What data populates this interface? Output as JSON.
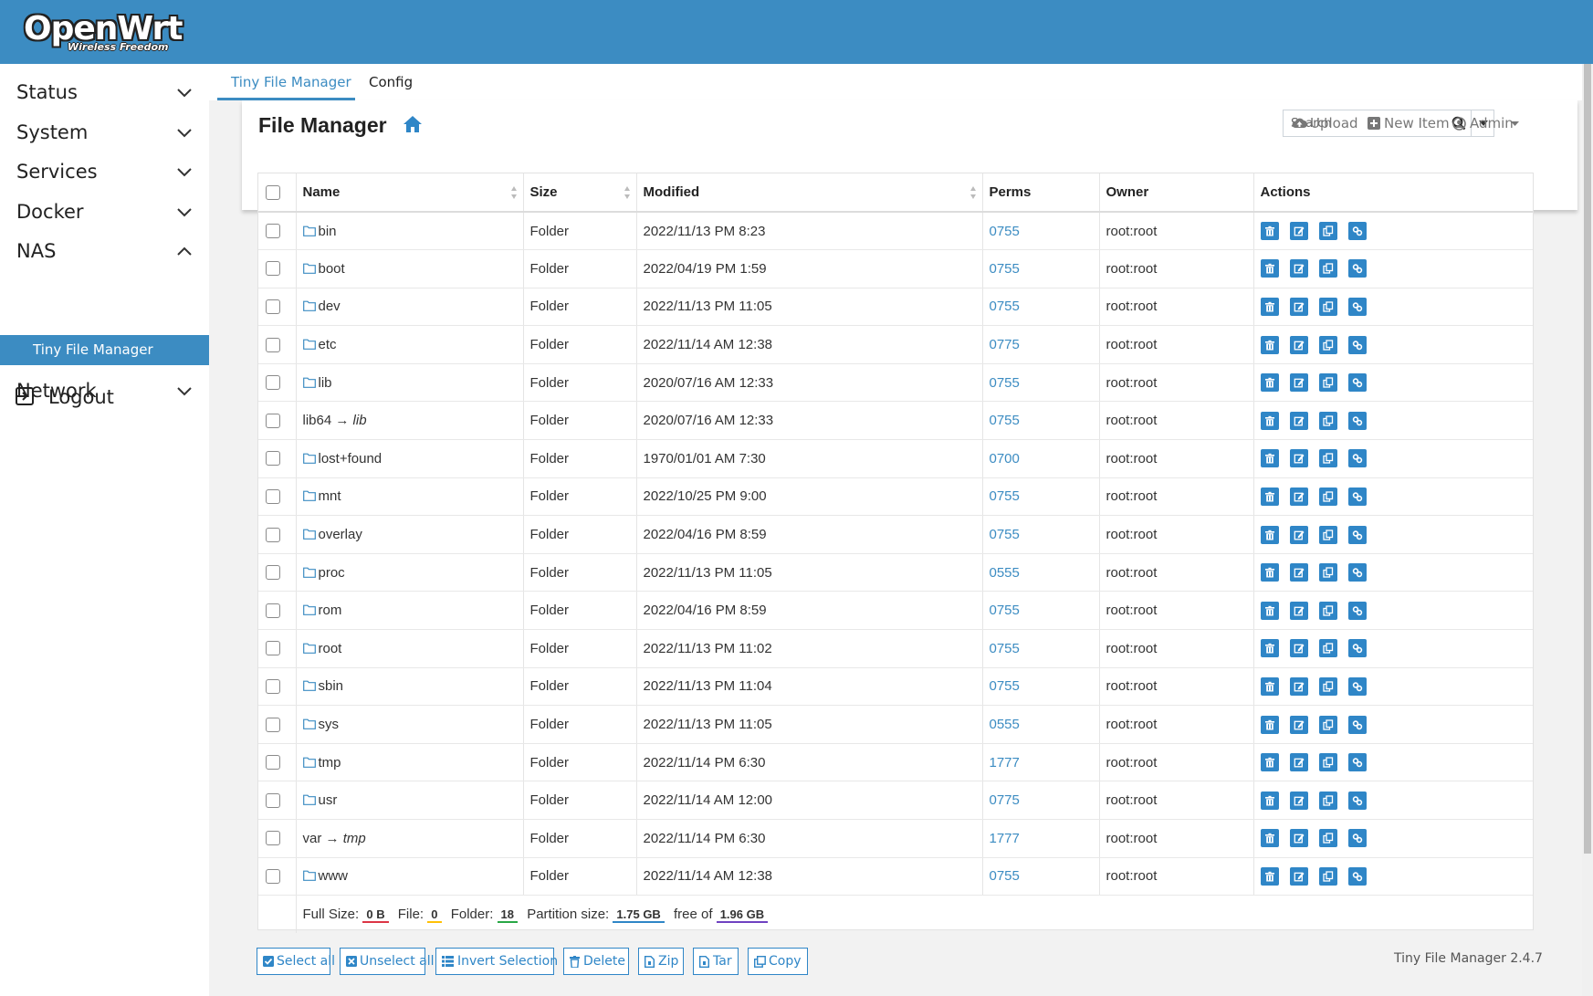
{
  "brand": {
    "name": "OpenWrt",
    "tagline": "Wireless Freedom"
  },
  "sidebar": {
    "items": [
      {
        "label": "Status",
        "expanded": false
      },
      {
        "label": "System",
        "expanded": false
      },
      {
        "label": "Services",
        "expanded": false
      },
      {
        "label": "Docker",
        "expanded": false
      },
      {
        "label": "NAS",
        "expanded": true
      },
      {
        "label": "Network",
        "expanded": false
      }
    ],
    "active_sub": "Tiny File Manager",
    "logout": "Logout"
  },
  "tabs": [
    {
      "label": "Tiny File Manager",
      "active": true
    },
    {
      "label": "Config",
      "active": false
    }
  ],
  "header": {
    "title": "File Manager",
    "search_placeholder": "Search",
    "upload": "Upload",
    "new_item": "New Item",
    "admin": "Admin"
  },
  "table": {
    "columns": [
      "Name",
      "Size",
      "Modified",
      "Perms",
      "Owner",
      "Actions"
    ],
    "rows": [
      {
        "name": "bin",
        "link": "",
        "size": "Folder",
        "modified": "2022/11/13 PM 8:23",
        "perms": "0755",
        "owner": "root:root"
      },
      {
        "name": "boot",
        "link": "",
        "size": "Folder",
        "modified": "2022/04/19 PM 1:59",
        "perms": "0755",
        "owner": "root:root"
      },
      {
        "name": "dev",
        "link": "",
        "size": "Folder",
        "modified": "2022/11/13 PM 11:05",
        "perms": "0755",
        "owner": "root:root"
      },
      {
        "name": "etc",
        "link": "",
        "size": "Folder",
        "modified": "2022/11/14 AM 12:38",
        "perms": "0775",
        "owner": "root:root"
      },
      {
        "name": "lib",
        "link": "",
        "size": "Folder",
        "modified": "2020/07/16 AM 12:33",
        "perms": "0755",
        "owner": "root:root"
      },
      {
        "name": "lib64",
        "link": "lib",
        "size": "Folder",
        "modified": "2020/07/16 AM 12:33",
        "perms": "0755",
        "owner": "root:root"
      },
      {
        "name": "lost+found",
        "link": "",
        "size": "Folder",
        "modified": "1970/01/01 AM 7:30",
        "perms": "0700",
        "owner": "root:root"
      },
      {
        "name": "mnt",
        "link": "",
        "size": "Folder",
        "modified": "2022/10/25 PM 9:00",
        "perms": "0755",
        "owner": "root:root"
      },
      {
        "name": "overlay",
        "link": "",
        "size": "Folder",
        "modified": "2022/04/16 PM 8:59",
        "perms": "0755",
        "owner": "root:root"
      },
      {
        "name": "proc",
        "link": "",
        "size": "Folder",
        "modified": "2022/11/13 PM 11:05",
        "perms": "0555",
        "owner": "root:root"
      },
      {
        "name": "rom",
        "link": "",
        "size": "Folder",
        "modified": "2022/04/16 PM 8:59",
        "perms": "0755",
        "owner": "root:root"
      },
      {
        "name": "root",
        "link": "",
        "size": "Folder",
        "modified": "2022/11/13 PM 11:02",
        "perms": "0755",
        "owner": "root:root"
      },
      {
        "name": "sbin",
        "link": "",
        "size": "Folder",
        "modified": "2022/11/13 PM 11:04",
        "perms": "0755",
        "owner": "root:root"
      },
      {
        "name": "sys",
        "link": "",
        "size": "Folder",
        "modified": "2022/11/13 PM 11:05",
        "perms": "0555",
        "owner": "root:root"
      },
      {
        "name": "tmp",
        "link": "",
        "size": "Folder",
        "modified": "2022/11/14 PM 6:30",
        "perms": "1777",
        "owner": "root:root"
      },
      {
        "name": "usr",
        "link": "",
        "size": "Folder",
        "modified": "2022/11/14 AM 12:00",
        "perms": "0775",
        "owner": "root:root"
      },
      {
        "name": "var",
        "link": "tmp",
        "size": "Folder",
        "modified": "2022/11/14 PM 6:30",
        "perms": "1777",
        "owner": "root:root"
      },
      {
        "name": "www",
        "link": "",
        "size": "Folder",
        "modified": "2022/11/14 AM 12:38",
        "perms": "0755",
        "owner": "root:root"
      }
    ],
    "link_arrow": "→"
  },
  "summary": {
    "full_size_label": "Full Size:",
    "full_size": "0 B",
    "file_label": "File:",
    "file": "0",
    "folder_label": "Folder:",
    "folder": "18",
    "partition_label": "Partition size:",
    "partition": "1.75 GB",
    "free_label": "free of",
    "total": "1.96 GB",
    "colors": {
      "full_size": "#dc3545",
      "file": "#ffc107",
      "folder": "#28a745",
      "partition": "#2f86c7",
      "total": "#6f42c1"
    }
  },
  "footer_buttons": [
    "Select all",
    "Unselect all",
    "Invert Selection",
    "Delete",
    "Zip",
    "Tar",
    "Copy"
  ],
  "version": "Tiny File Manager 2.4.7",
  "colors": {
    "accent": "#3c8cc2",
    "action": "#2f86c7"
  }
}
